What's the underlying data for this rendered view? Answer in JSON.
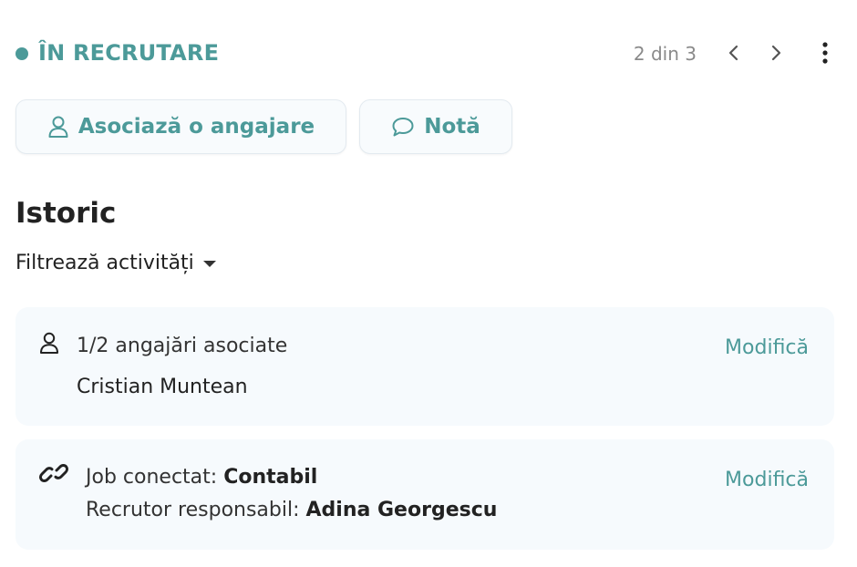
{
  "status": {
    "label": "ÎN RECRUTARE",
    "color": "#4c9a99"
  },
  "pager": {
    "text": "2 din 3"
  },
  "icons": {
    "prev": "chevron-left-icon",
    "next": "chevron-right-icon",
    "menu": "vertical-dots-icon",
    "person": "person-icon",
    "comment": "comment-icon",
    "link": "link-icon",
    "caret": "caret-down-icon"
  },
  "actions": {
    "associate_label": "Asociază o angajare",
    "note_label": "Notă"
  },
  "history": {
    "title": "Istoric",
    "filter_label": "Filtrează activități"
  },
  "cards": [
    {
      "summary": "1/2 angajări asociate",
      "name": "Cristian Muntean",
      "edit_label": "Modifică"
    },
    {
      "job_prefix": "Job conectat: ",
      "job_value": "Contabil",
      "recruiter_prefix": "Recrutor responsabil: ",
      "recruiter_value": "Adina Georgescu",
      "edit_label": "Modifică"
    }
  ]
}
